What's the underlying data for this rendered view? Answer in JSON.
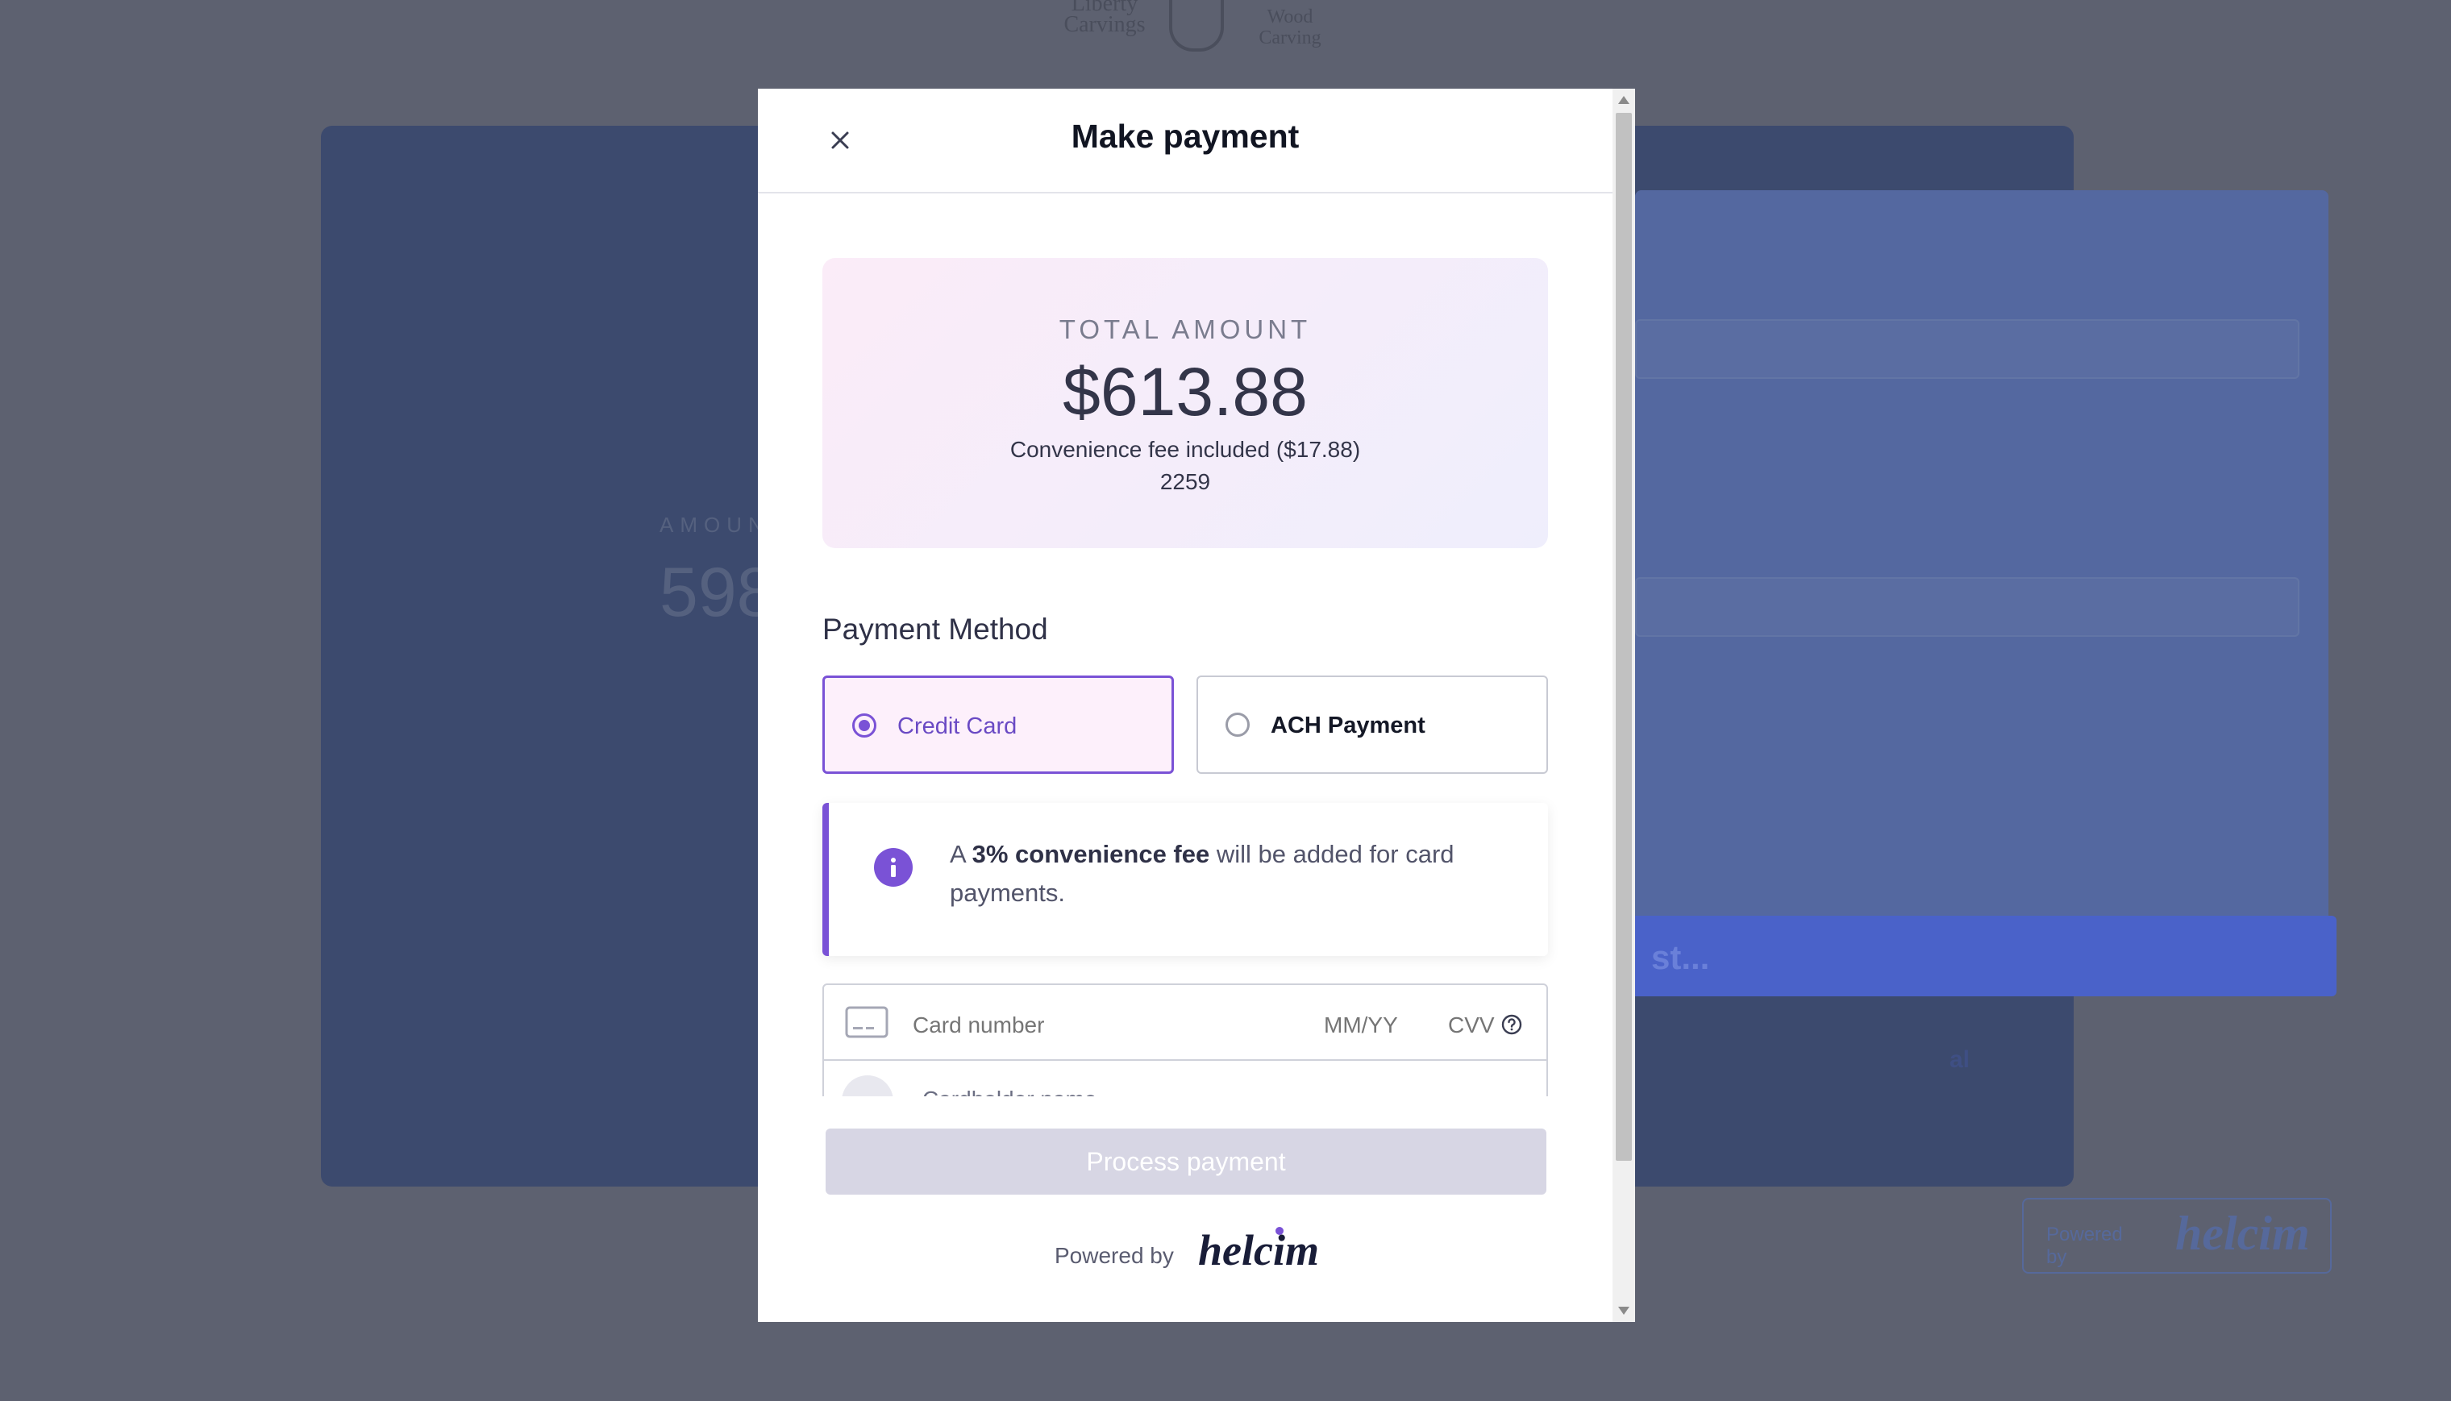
{
  "modal": {
    "title": "Make payment"
  },
  "total": {
    "label": "TOTAL AMOUNT",
    "amount": "$613.88",
    "fee_note": "Convenience fee included ($17.88)",
    "reference": "2259"
  },
  "payment_method": {
    "heading": "Payment Method",
    "options": [
      {
        "label": "Credit Card",
        "selected": true
      },
      {
        "label": "ACH Payment",
        "selected": false
      }
    ]
  },
  "notice": {
    "prefix": "A ",
    "emphasis": "3% convenience fee",
    "suffix": " will be added for card payments."
  },
  "card_form": {
    "card_number_placeholder": "Card number",
    "expiry_placeholder": "MM/YY",
    "cvv_placeholder": "CVV",
    "cardholder_placeholder": "Cardholder name"
  },
  "actions": {
    "process_label": "Process payment"
  },
  "branding": {
    "powered_by": "Powered by",
    "logo": "helcim"
  },
  "background": {
    "logo_left": "Liberty Carvings",
    "logo_right": "Wood Carving",
    "amount_label": "AMOUNT",
    "amount_value": "598",
    "button_text": "st...",
    "link_text": "al",
    "footer_powered": "Powered by",
    "footer_logo": "helcim"
  },
  "colors": {
    "accent": "#7a52d6",
    "title": "#111522",
    "disabled_button": "#d7d6e4"
  },
  "icons": {
    "close": "close-icon",
    "info": "info-icon",
    "card": "credit-card-icon",
    "cvv_help": "question-circle-icon",
    "cardholder": "person-icon"
  }
}
